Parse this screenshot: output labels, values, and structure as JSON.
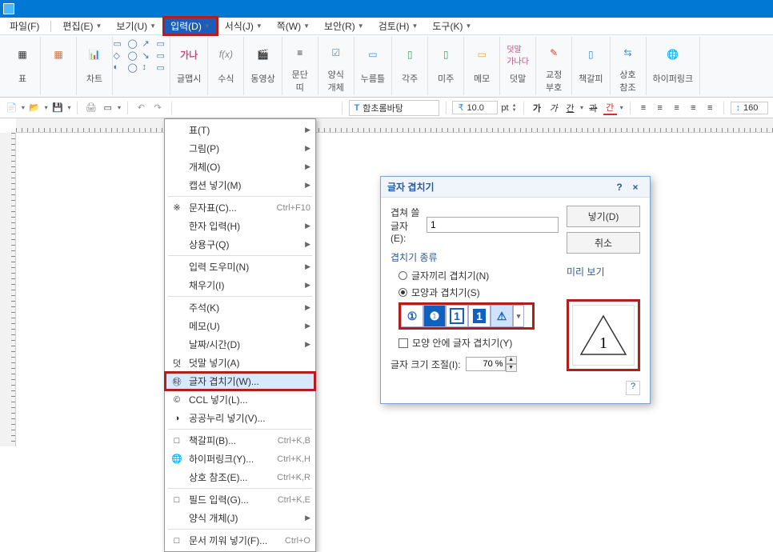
{
  "menubar": {
    "file": "파일(F)",
    "edit": "편집(E)",
    "view": "보기(U)",
    "input": "입력(D)",
    "format": "서식(J)",
    "page": "쪽(W)",
    "security": "보안(R)",
    "review": "검토(H)",
    "tools": "도구(K)"
  },
  "ribbon": {
    "table": "표",
    "chart": "차트",
    "gallery": "글맵시",
    "formula": "수식",
    "video": "동영상",
    "textbox": "문단\n띠",
    "styleset": "양식\n개체",
    "numframe": "누름틀",
    "footnote": "각주",
    "endnote": "미주",
    "memo": "메모",
    "comment": "덧말",
    "proof": "교정\n부호",
    "bookmark": "책갈피",
    "crossref": "상호\n참조",
    "hyperlink": "하이퍼링크"
  },
  "subtoolbar": {
    "fontCombo": "함초롬바탕",
    "size": "10.0",
    "sizeUnit": "pt",
    "bold": "가",
    "italic": "가",
    "underline": "간",
    "strike": "과",
    "color": "간",
    "zoom": "160"
  },
  "dropdown": {
    "items": [
      {
        "label": "표(T)",
        "arrow": true
      },
      {
        "label": "그림(P)",
        "arrow": true
      },
      {
        "label": "개체(O)",
        "arrow": true
      },
      {
        "label": "캡션 넣기(M)",
        "arrow": true
      },
      {
        "sep": true
      },
      {
        "label": "문자표(C)...",
        "shortcut": "Ctrl+F10",
        "ico": "※"
      },
      {
        "label": "한자 입력(H)",
        "arrow": true
      },
      {
        "label": "상용구(Q)",
        "arrow": true
      },
      {
        "sep": true
      },
      {
        "label": "입력 도우미(N)",
        "arrow": true
      },
      {
        "label": "채우기(I)",
        "arrow": true
      },
      {
        "sep": true
      },
      {
        "label": "주석(K)",
        "arrow": true
      },
      {
        "label": "메모(U)",
        "arrow": true
      },
      {
        "label": "날짜/시간(D)",
        "arrow": true
      },
      {
        "label": "덧말 넣기(A)",
        "ico": "덧"
      },
      {
        "label": "글자 겹치기(W)...",
        "highlight": true,
        "ico": "㉹"
      },
      {
        "label": "CCL 넣기(L)...",
        "ico": "©"
      },
      {
        "label": "공공누리 넣기(V)...",
        "ico": "◑"
      },
      {
        "sep": true
      },
      {
        "label": "책갈피(B)...",
        "shortcut": "Ctrl+K,B",
        "ico": "□"
      },
      {
        "label": "하이퍼링크(Y)...",
        "shortcut": "Ctrl+K,H",
        "ico": "🌐"
      },
      {
        "label": "상호 참조(E)...",
        "shortcut": "Ctrl+K,R"
      },
      {
        "sep": true
      },
      {
        "label": "필드 입력(G)...",
        "shortcut": "Ctrl+K,E",
        "ico": "□"
      },
      {
        "label": "양식 개체(J)",
        "arrow": true
      },
      {
        "sep": true
      },
      {
        "label": "문서 끼워 넣기(F)...",
        "shortcut": "Ctrl+O",
        "ico": "□"
      }
    ]
  },
  "dialog": {
    "title": "글자 겹치기",
    "overlapLabel": "겹쳐 쓸 글자(E):",
    "overlapValue": "1",
    "insertBtn": "넣기(D)",
    "cancelBtn": "취소",
    "groupTitle": "겹치기 종류",
    "radio1": "글자끼리 겹치기(N)",
    "radio2": "모양과 겹치기(S)",
    "checkLabel": "모양 안에 글자 겹치기(Y)",
    "sizeLabel": "글자 크기 조절(I):",
    "sizeValue": "70 %",
    "previewTitle": "미리 보기",
    "help": "?",
    "close": "×"
  }
}
